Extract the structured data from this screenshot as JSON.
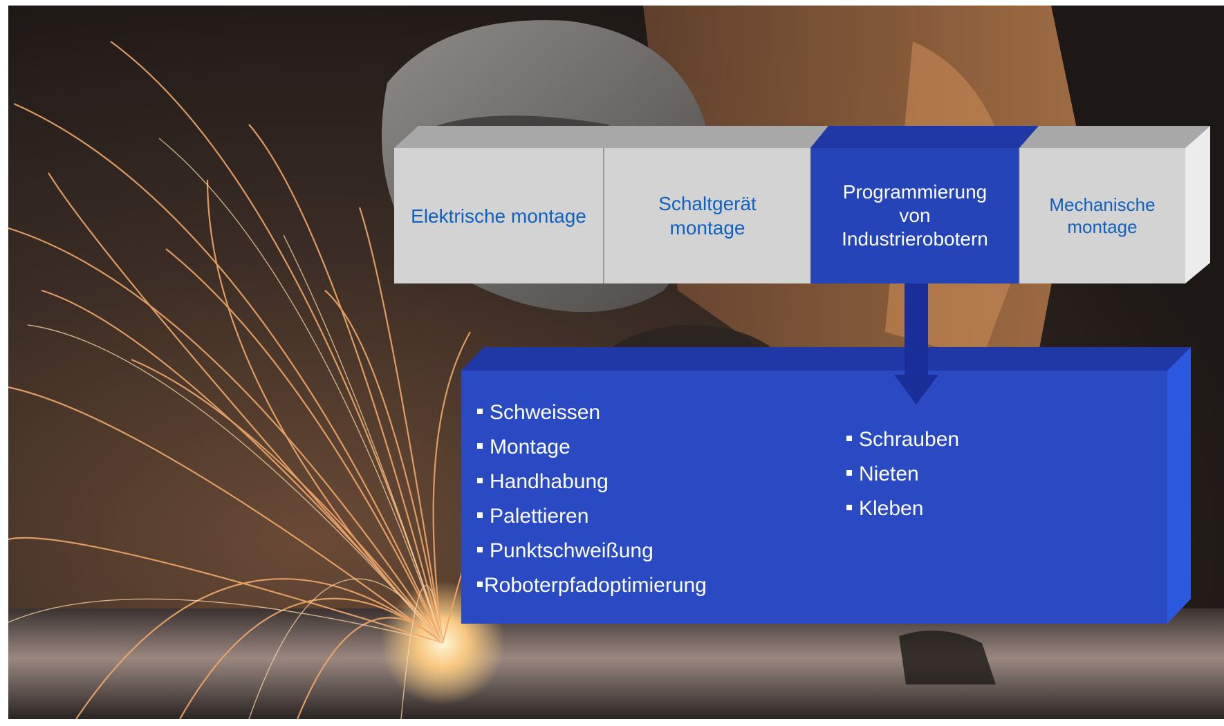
{
  "tabs": [
    {
      "lines": [
        "Elektrische montage"
      ],
      "active": false
    },
    {
      "lines": [
        "Schaltgerät",
        "montage"
      ],
      "active": false
    },
    {
      "lines": [
        "Programmierung",
        "von",
        "Industrierobotern"
      ],
      "active": true
    },
    {
      "lines": [
        "Mechanische",
        "montage"
      ],
      "active": false
    }
  ],
  "details": {
    "left_items": [
      "Schweissen",
      "Montage",
      "Handhabung",
      "Palettieren",
      "Punktschweißung",
      "Roboterpfadoptimierung"
    ],
    "right_items": [
      "Schrauben",
      "Nieten",
      "Kleben"
    ]
  },
  "colors": {
    "tab_inactive_text": "#1060c0",
    "tab_active_bg": "#2544b8",
    "tab_inactive_bg": "#d2d2d2",
    "panel_bg": "#2a4ac4",
    "arrow": "#1a2e9a"
  },
  "background": {
    "subject": "welding-photo"
  }
}
